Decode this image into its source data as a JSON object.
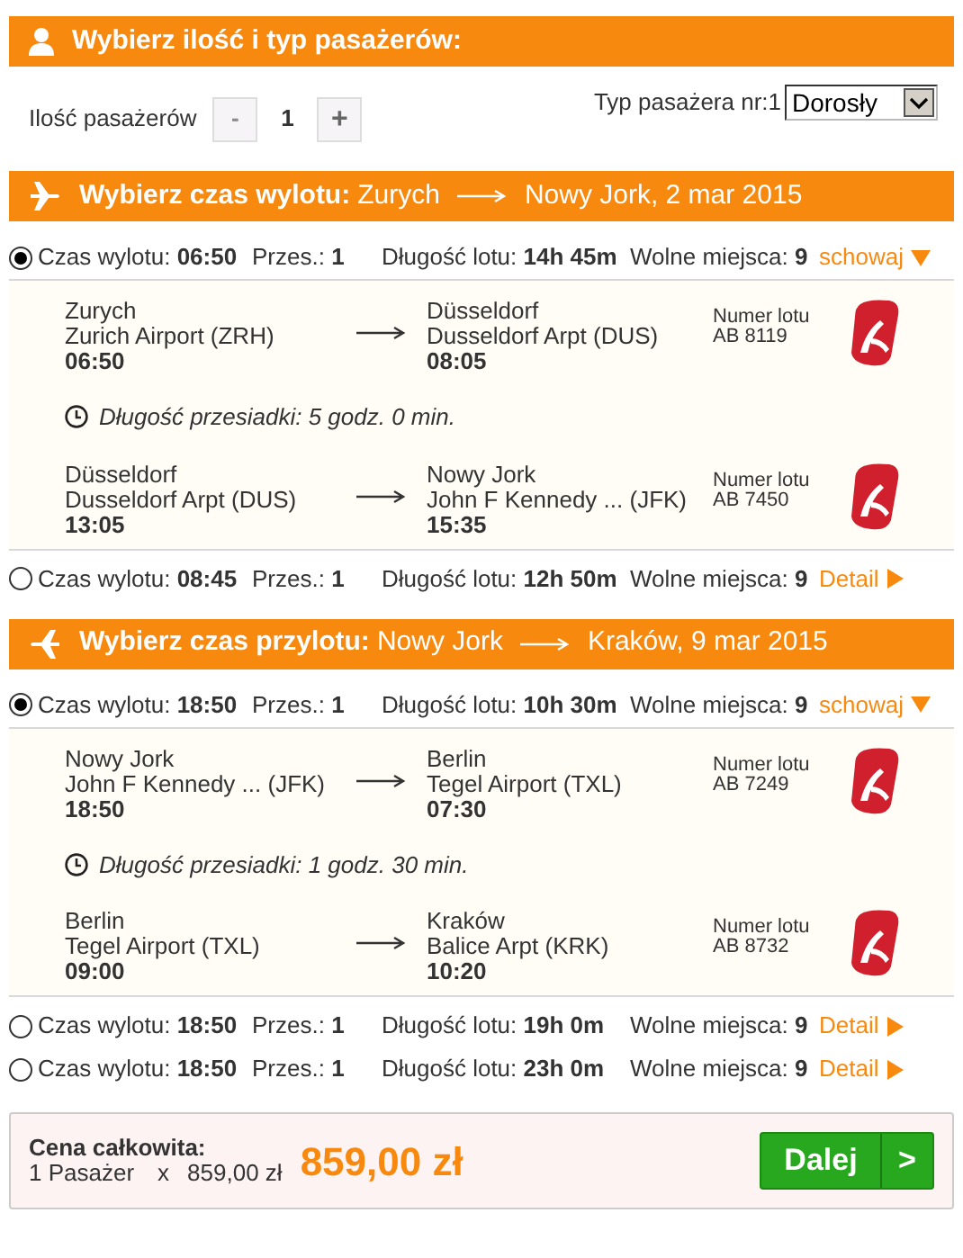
{
  "passengers": {
    "title": "Wybierz ilość i typ pasażerów:",
    "count_label": "Ilość pasażerów",
    "minus": {
      "label": "-",
      "disabled": true
    },
    "count": "1",
    "plus": {
      "label": "+",
      "disabled": false
    },
    "type_label": "Typ pasażera nr:1",
    "type_value": "Dorosły"
  },
  "flights": [
    {
      "kind": "departure",
      "title": "Wybierz czas wylotu:",
      "from": "Zurych",
      "to": "Nowy Jork, 2 mar 2015",
      "options": [
        {
          "selected": true,
          "time_label": "Czas wylotu:",
          "time": "06:50",
          "stops_label": "Przes.:",
          "stops": "1",
          "duration_label": "Długość lotu:",
          "duration": "14h 45m",
          "seats_label": "Wolne miejsca:",
          "seats": "9",
          "toggle": "schowaj",
          "expanded": true,
          "segments": [
            {
              "from_city": "Zurych",
              "from_airport": "Zurich Airport (ZRH)",
              "dep": "06:50",
              "to_city": "Düsseldorf",
              "to_airport": "Dusseldorf Arpt (DUS)",
              "arr": "08:05",
              "number_label": "Numer lotu",
              "number": "AB 8119"
            },
            {
              "from_city": "Düsseldorf",
              "from_airport": "Dusseldorf Arpt (DUS)",
              "dep": "13:05",
              "to_city": "Nowy Jork",
              "to_airport": "John F Kennedy ... (JFK)",
              "arr": "15:35",
              "number_label": "Numer lotu",
              "number": "AB 7450"
            }
          ],
          "layover": "Długość przesiadki: 5 godz. 0 min."
        },
        {
          "selected": false,
          "time_label": "Czas wylotu:",
          "time": "08:45",
          "stops_label": "Przes.:",
          "stops": "1",
          "duration_label": "Długość lotu:",
          "duration": "12h 50m",
          "seats_label": "Wolne miejsca:",
          "seats": "9",
          "toggle": "Detail",
          "expanded": false
        }
      ]
    },
    {
      "kind": "arrival",
      "title": "Wybierz czas przylotu:",
      "from": "Nowy Jork",
      "to": "Kraków, 9 mar 2015",
      "options": [
        {
          "selected": true,
          "time_label": "Czas wylotu:",
          "time": "18:50",
          "stops_label": "Przes.:",
          "stops": "1",
          "duration_label": "Długość lotu:",
          "duration": "10h 30m",
          "seats_label": "Wolne miejsca:",
          "seats": "9",
          "toggle": "schowaj",
          "expanded": true,
          "segments": [
            {
              "from_city": "Nowy Jork",
              "from_airport": "John F Kennedy ... (JFK)",
              "dep": "18:50",
              "to_city": "Berlin",
              "to_airport": "Tegel Airport (TXL)",
              "arr": "07:30",
              "number_label": "Numer lotu",
              "number": "AB 7249"
            },
            {
              "from_city": "Berlin",
              "from_airport": "Tegel Airport (TXL)",
              "dep": "09:00",
              "to_city": "Kraków",
              "to_airport": "Balice Arpt (KRK)",
              "arr": "10:20",
              "number_label": "Numer lotu",
              "number": "AB 8732"
            }
          ],
          "layover": "Długość przesiadki: 1 godz. 30 min."
        },
        {
          "selected": false,
          "time_label": "Czas wylotu:",
          "time": "18:50",
          "stops_label": "Przes.:",
          "stops": "1",
          "duration_label": "Długość lotu:",
          "duration": "19h 0m",
          "seats_label": "Wolne miejsca:",
          "seats": "9",
          "toggle": "Detail",
          "expanded": false
        },
        {
          "selected": false,
          "time_label": "Czas wylotu:",
          "time": "18:50",
          "stops_label": "Przes.:",
          "stops": "1",
          "duration_label": "Długość lotu:",
          "duration": "23h 0m",
          "seats_label": "Wolne miejsca:",
          "seats": "9",
          "toggle": "Detail",
          "expanded": false
        }
      ]
    }
  ],
  "total": {
    "label": "Cena całkowita:",
    "passengers": "1 Pasażer",
    "times": "x",
    "unit_price": "859,00 zł",
    "price": "859,00 zł",
    "next_button": "Dalej",
    "next_arrow": ">"
  }
}
